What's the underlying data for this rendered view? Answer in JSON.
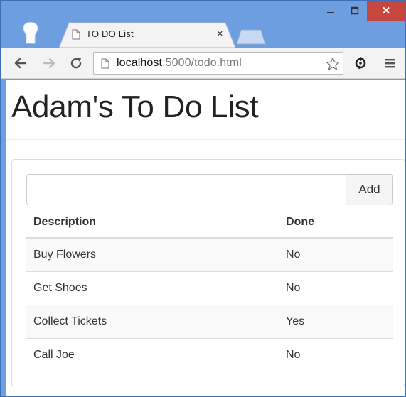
{
  "browser": {
    "tab_title": "TO DO List",
    "tab_close": "×",
    "window_close": "✕",
    "url_host": "localhost",
    "url_rest": ":5000/todo.html"
  },
  "page": {
    "heading": "Adam's To Do List",
    "input": {
      "value": "",
      "placeholder": ""
    },
    "add_label": "Add",
    "columns": [
      "Description",
      "Done"
    ],
    "items": [
      {
        "description": "Buy Flowers",
        "done": "No"
      },
      {
        "description": "Get Shoes",
        "done": "No"
      },
      {
        "description": "Collect Tickets",
        "done": "Yes"
      },
      {
        "description": "Call Joe",
        "done": "No"
      }
    ]
  },
  "icons": {
    "back": "back-arrow-icon",
    "forward": "forward-arrow-icon",
    "reload": "reload-icon",
    "page": "page-icon",
    "bookmark": "star-icon",
    "extension": "sync-icon",
    "menu": "menu-icon"
  },
  "colors": {
    "window_frame": "#6d9fe0",
    "close_button": "#c7463d",
    "toolbar": "#f3f3f3"
  }
}
